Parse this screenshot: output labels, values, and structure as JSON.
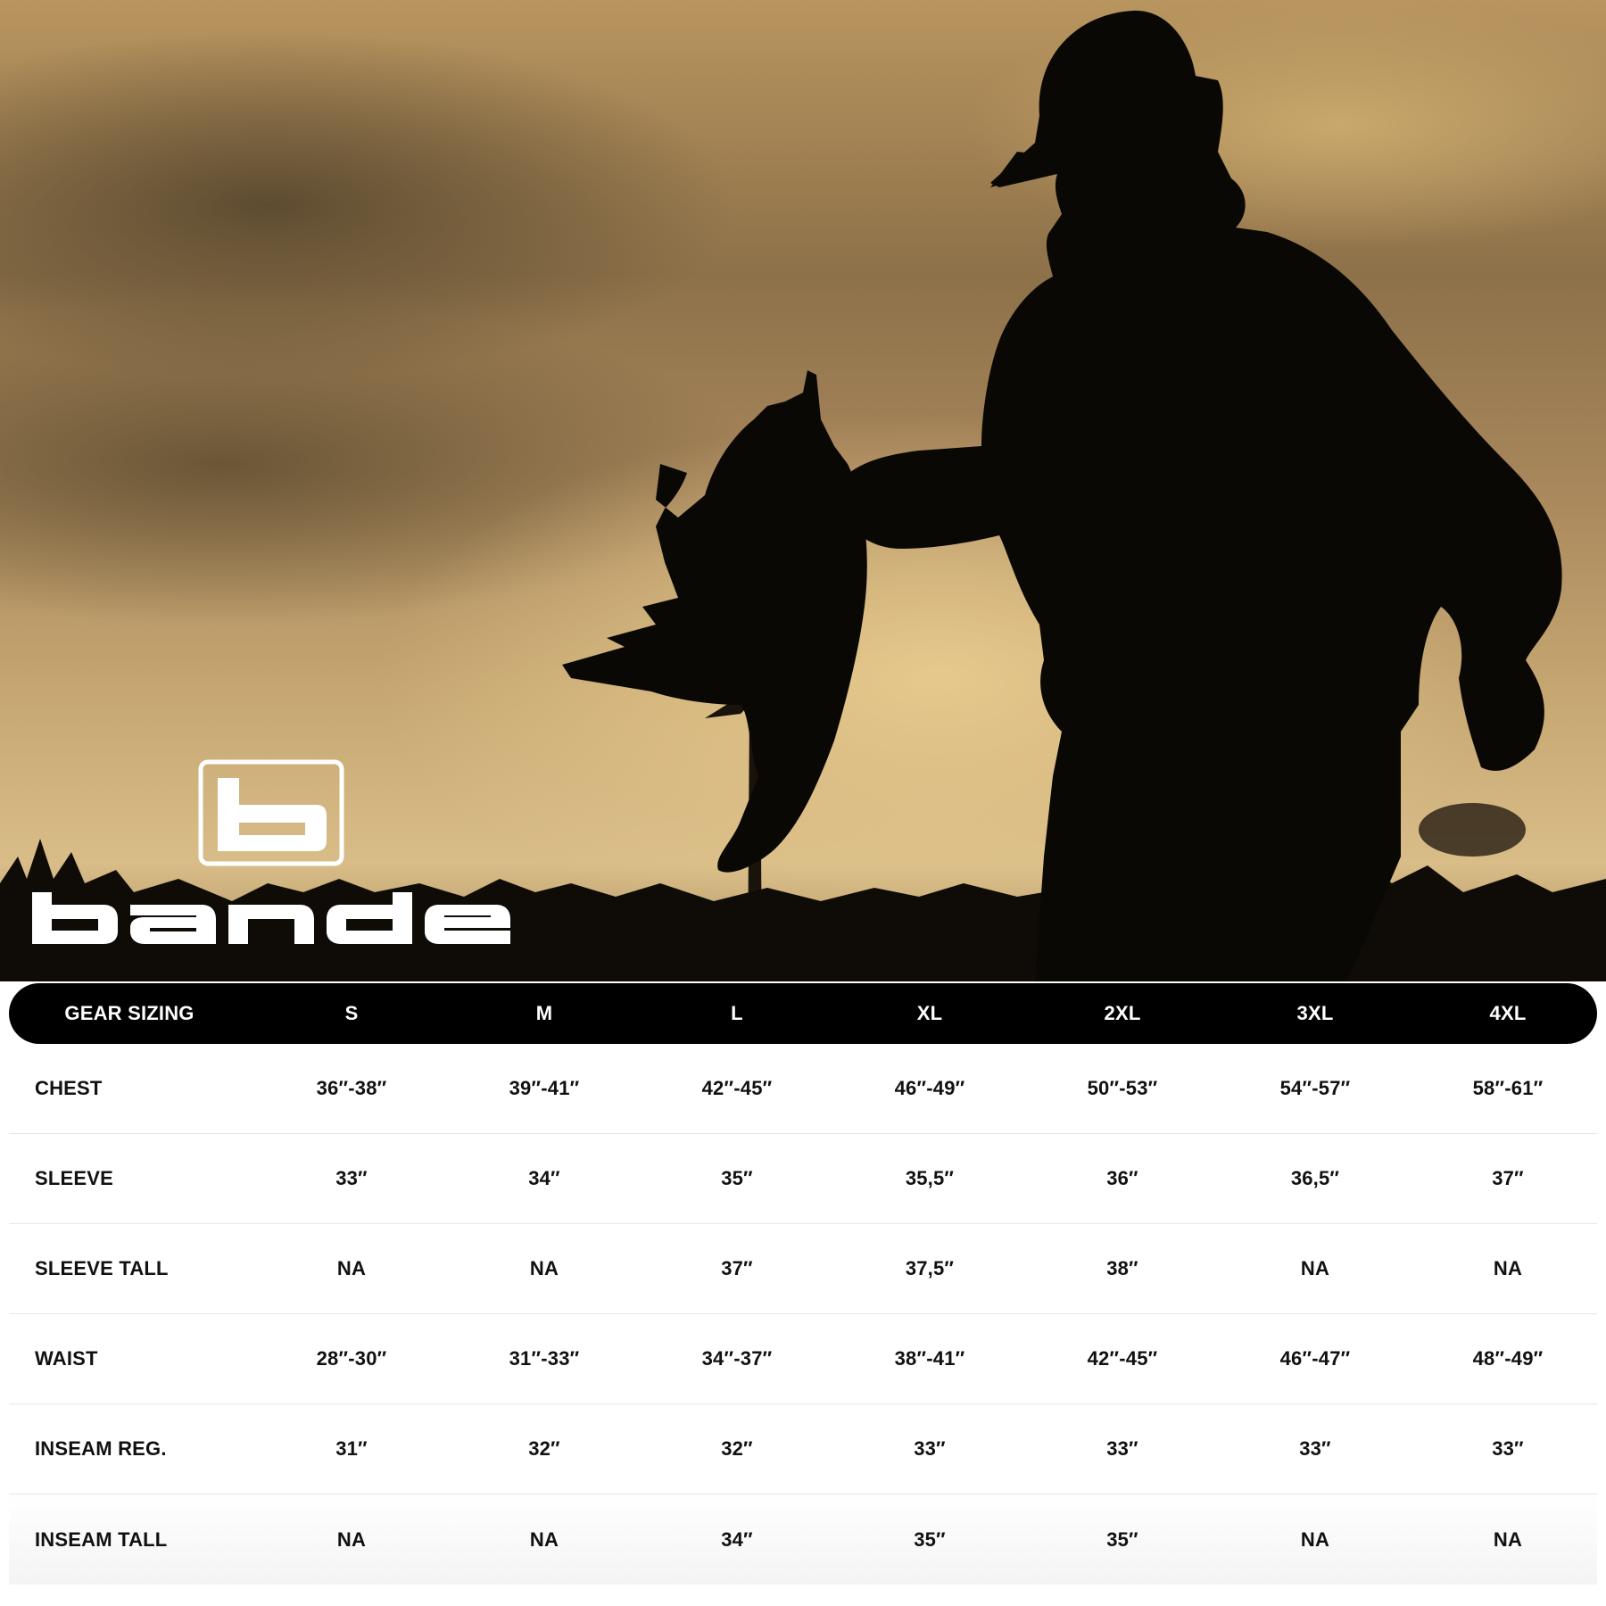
{
  "brand": {
    "name": "banded",
    "logo_icon": "banded-b-logo-icon"
  },
  "colors": {
    "header_bg": "#000000",
    "header_text": "#ffffff",
    "row_text": "#111111",
    "divider": "#e6e6e6",
    "sky": "#c5a671"
  },
  "table": {
    "header_label": "GEAR SIZING",
    "sizes": [
      "S",
      "M",
      "L",
      "XL",
      "2XL",
      "3XL",
      "4XL"
    ],
    "rows": [
      {
        "label": "CHEST",
        "values": [
          "36″-38″",
          "39″-41″",
          "42″-45″",
          "46″-49″",
          "50″-53″",
          "54″-57″",
          "58″-61″"
        ]
      },
      {
        "label": "SLEEVE",
        "values": [
          "33″",
          "34″",
          "35″",
          "35,5″",
          "36″",
          "36,5″",
          "37″"
        ]
      },
      {
        "label": "SLEEVE TALL",
        "values": [
          "NA",
          "NA",
          "37″",
          "37,5″",
          "38″",
          "NA",
          "NA"
        ]
      },
      {
        "label": "WAIST",
        "values": [
          "28″-30″",
          "31″-33″",
          "34″-37″",
          "38″-41″",
          "42″-45″",
          "46″-47″",
          "48″-49″"
        ]
      },
      {
        "label": "INSEAM REG.",
        "values": [
          "31″",
          "32″",
          "32″",
          "33″",
          "33″",
          "33″",
          "33″"
        ]
      },
      {
        "label": "INSEAM TALL",
        "values": [
          "NA",
          "NA",
          "34″",
          "35″",
          "35″",
          "NA",
          "NA"
        ]
      }
    ]
  }
}
